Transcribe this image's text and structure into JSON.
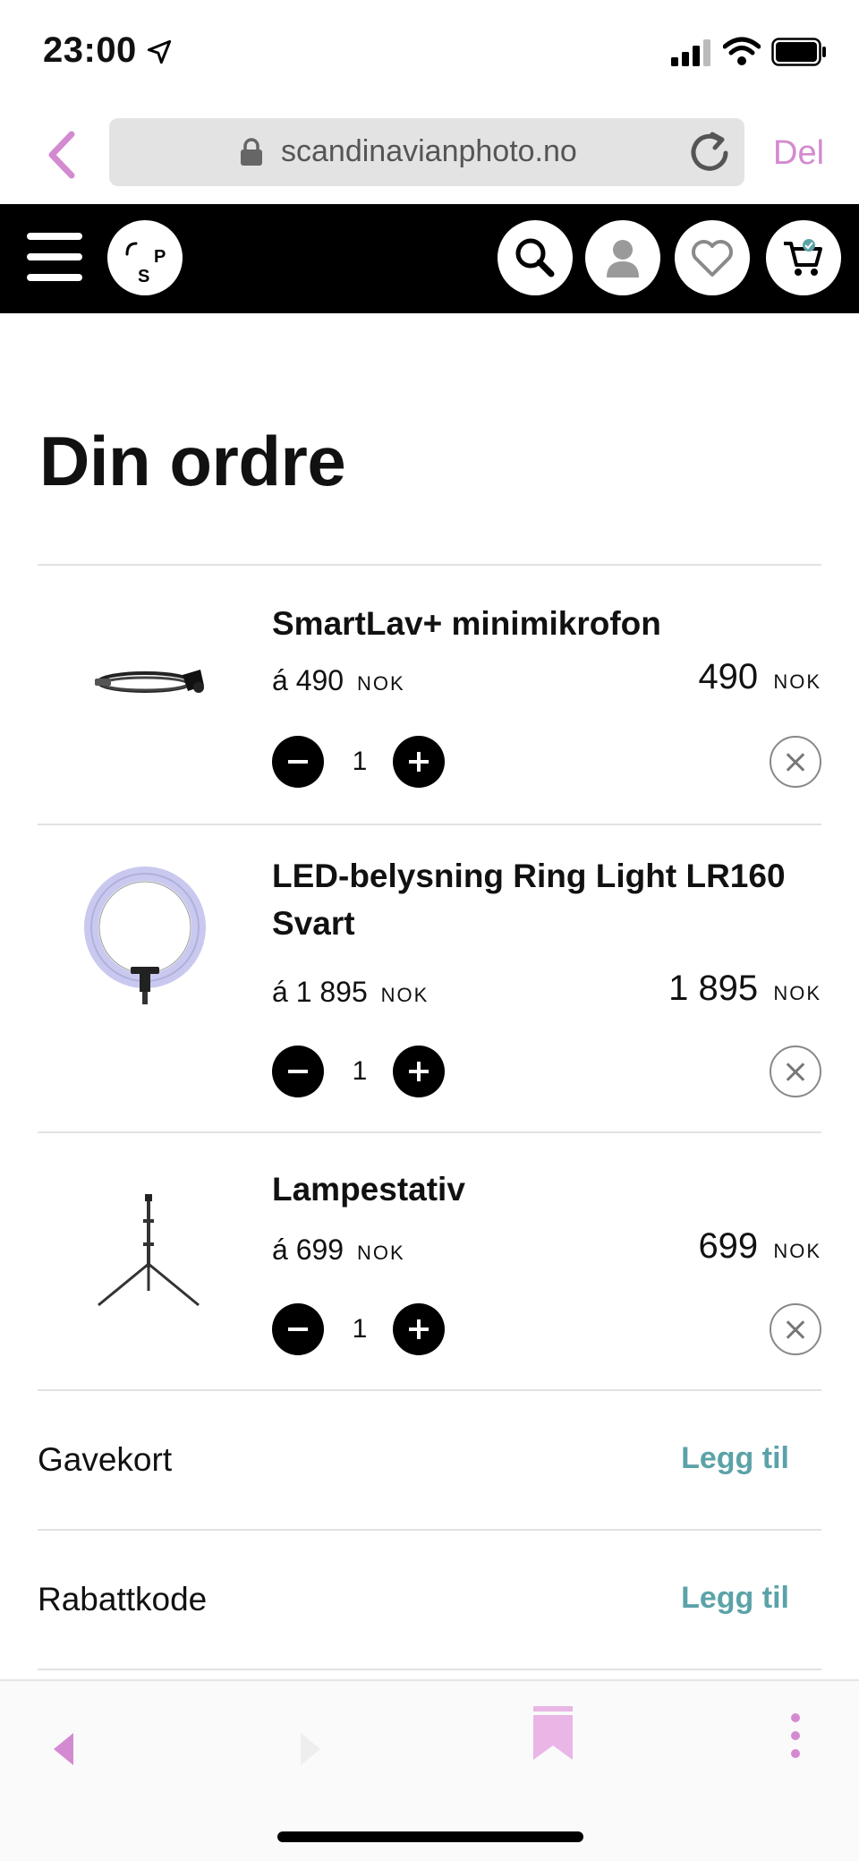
{
  "status_bar": {
    "time": "23:00"
  },
  "browser": {
    "url": "scandinavianphoto.no",
    "share_label": "Del"
  },
  "site_header": {
    "logo_letters": [
      "S",
      "P"
    ],
    "icons": [
      "search-icon",
      "user-icon",
      "heart-icon",
      "cart-icon"
    ]
  },
  "page": {
    "title": "Din ordre"
  },
  "items": [
    {
      "name": "SmartLav+ minimikrofon",
      "unit_prefix": "á",
      "unit_price": "490",
      "currency": "NOK",
      "line_total": "490",
      "quantity": "1",
      "image_icon": "microphone-cable-icon"
    },
    {
      "name": "LED-belysning Ring Light LR160 Svart",
      "unit_prefix": "á",
      "unit_price": "1 895",
      "currency": "NOK",
      "line_total": "1 895",
      "quantity": "1",
      "image_icon": "ring-light-icon"
    },
    {
      "name": "Lampestativ",
      "unit_prefix": "á",
      "unit_price": "699",
      "currency": "NOK",
      "line_total": "699",
      "quantity": "1",
      "image_icon": "tripod-stand-icon"
    }
  ],
  "extras": [
    {
      "label": "Gavekort",
      "action": "Legg til"
    },
    {
      "label": "Rabattkode",
      "action": "Legg til"
    }
  ],
  "colors": {
    "accent_pink": "#d48ad0",
    "accent_teal": "#5ba3a8",
    "header_bg": "#000000"
  }
}
